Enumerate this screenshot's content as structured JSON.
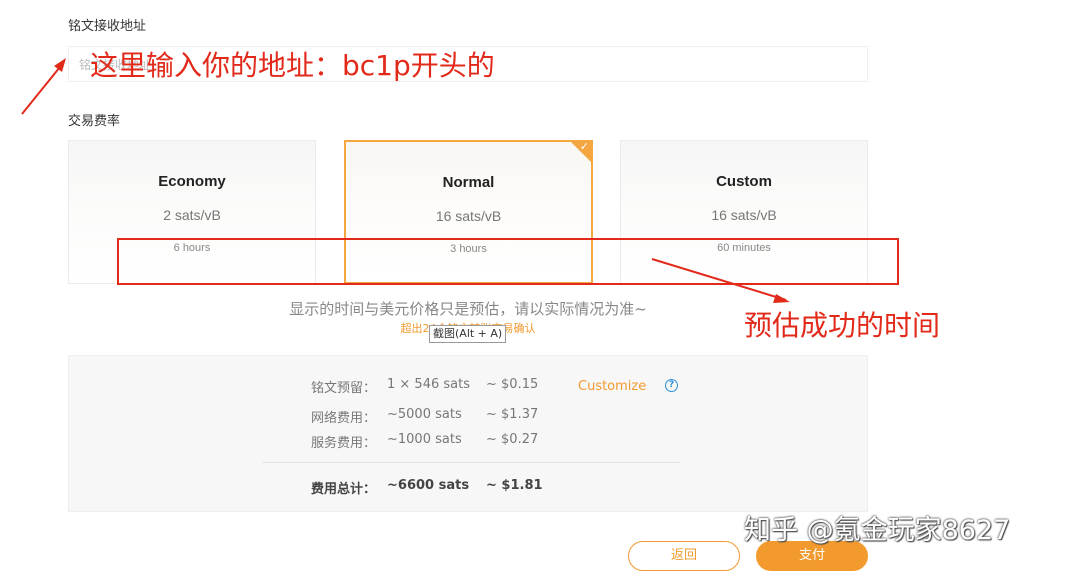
{
  "form": {
    "address_label": "铭文接收地址",
    "address_placeholder": "铭文接收地址",
    "fee_label": "交易费率"
  },
  "fee_options": [
    {
      "name": "Economy",
      "rate": "2 sats/vB",
      "time": "6 hours",
      "selected": false
    },
    {
      "name": "Normal",
      "rate": "16 sats/vB",
      "time": "3 hours",
      "selected": true
    },
    {
      "name": "Custom",
      "rate": "16 sats/vB",
      "time": "60 minutes",
      "selected": false
    }
  ],
  "notices": {
    "estimate": "显示的时间与美元价格只是预估，请以实际情况为准~",
    "warning": "超出24个铭文转账交易确认"
  },
  "tooltip": "截图(Alt + A)",
  "summary": {
    "rows": [
      {
        "label": "铭文预留：",
        "sats": "1 × 546  sats",
        "usd": "~ $0.15"
      },
      {
        "label": "网络费用：",
        "sats": "~5000  sats",
        "usd": "~ $1.37"
      },
      {
        "label": "服务费用：",
        "sats": "~1000  sats",
        "usd": "~ $0.27"
      }
    ],
    "total": {
      "label": "费用总计：",
      "sats": "~6600  sats",
      "usd": "~ $1.81"
    },
    "customize_label": "Customize",
    "help_icon": "?"
  },
  "buttons": {
    "back": "返回",
    "pay": "支付"
  },
  "annotations": {
    "address_hint": "这里输入你的地址：bc1p开头的",
    "time_hint": "预估成功的时间"
  },
  "watermark": "知乎 @氪金玩家8627",
  "colors": {
    "accent": "#f29a2e",
    "annotation": "#e22a1b",
    "help": "#2b8fd6"
  }
}
